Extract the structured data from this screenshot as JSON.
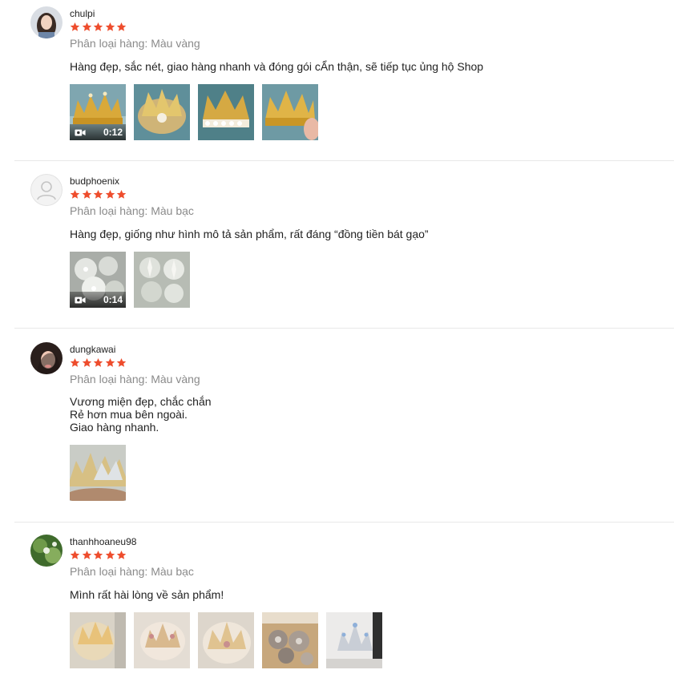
{
  "colors": {
    "star": "#ee4d2d",
    "variant": "#8a8a8a",
    "divider": "#e8e8e8"
  },
  "reviews": [
    {
      "username": "chulpi",
      "rating": 5,
      "variant": "Phân loại hàng: Màu vàng",
      "comment": [
        "Hàng đẹp, sắc nét, giao hàng nhanh và đóng gói cẨn thận, sẽ tiếp tục ủng hộ Shop"
      ],
      "media": [
        {
          "type": "video",
          "duration": "0:12",
          "subject": "gold crown"
        },
        {
          "type": "image",
          "subject": "gold crown"
        },
        {
          "type": "image",
          "subject": "gold crown with pearls"
        },
        {
          "type": "image",
          "subject": "gold crown"
        }
      ]
    },
    {
      "username": "budphoenix",
      "rating": 5,
      "variant": "Phân loại hàng: Màu bạc",
      "comment": [
        "Hàng đẹp, giống như hình mô tả sản phẩm, rất đáng “đồng tiền bát gạo”"
      ],
      "media": [
        {
          "type": "video",
          "duration": "0:14",
          "subject": "silver crowns"
        },
        {
          "type": "image",
          "subject": "silver crowns"
        }
      ]
    },
    {
      "username": "dungkawai",
      "rating": 5,
      "variant": "Phân loại hàng: Màu vàng",
      "comment": [
        "Vương miện đẹp, chắc chắn",
        "Rẻ hơn mua bên ngoài.",
        "Giao hàng nhanh."
      ],
      "media": [
        {
          "type": "image",
          "subject": "crowns in hand"
        }
      ]
    },
    {
      "username": "thanhhoaneu98",
      "rating": 5,
      "variant": "Phân loại hàng: Màu bạc",
      "comment": [
        "Mình rất hài lòng về sản phẩm!"
      ],
      "media": [
        {
          "type": "image",
          "subject": "packaged crown"
        },
        {
          "type": "image",
          "subject": "packaged crown"
        },
        {
          "type": "image",
          "subject": "packaged crown"
        },
        {
          "type": "image",
          "subject": "crowns in box"
        },
        {
          "type": "image",
          "subject": "silver crown"
        }
      ]
    }
  ]
}
